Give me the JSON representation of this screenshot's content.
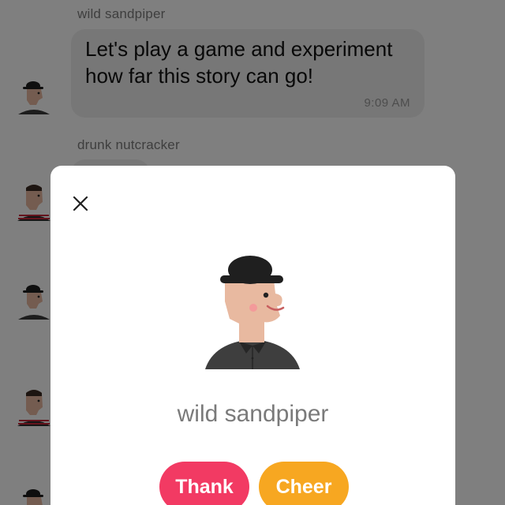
{
  "messages": [
    {
      "sender": "wild sandpiper",
      "text_line1": "Let's play a game and experiment",
      "text_line2": "how far this story can go!",
      "time": "9:09 AM"
    },
    {
      "sender": "drunk nutcracker"
    }
  ],
  "profile_modal": {
    "name": "wild sandpiper",
    "close_icon": "close-icon",
    "thank_label": "Thank",
    "cheer_label": "Cheer"
  },
  "colors": {
    "thank": "#f23a63",
    "cheer": "#f7a721",
    "overlay": "rgba(0,0,0,0.5)",
    "skin": "#e8b9a0"
  }
}
